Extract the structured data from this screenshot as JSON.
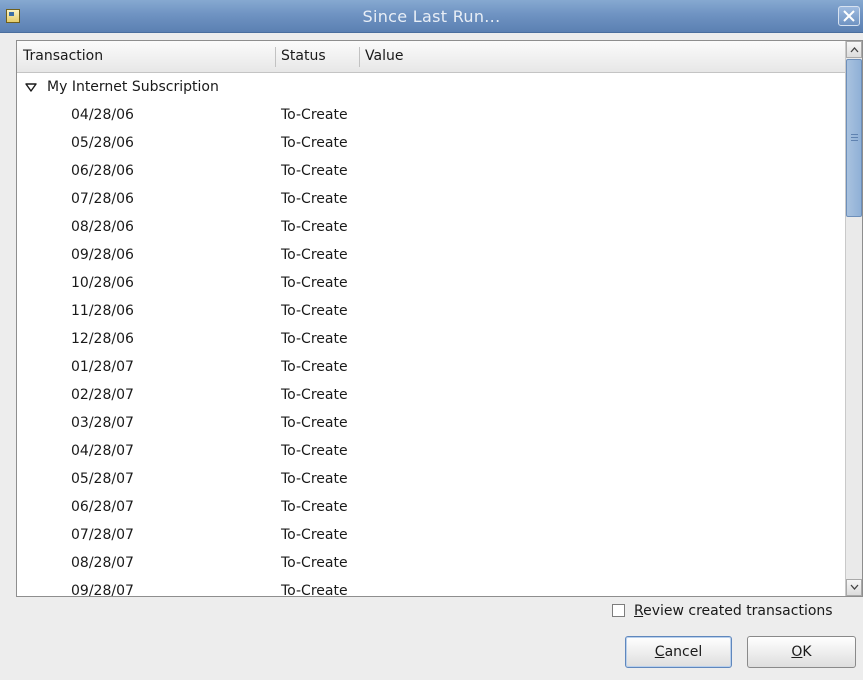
{
  "window": {
    "title": "Since Last Run...",
    "icon": "app-icon",
    "close_icon": "close-icon"
  },
  "table": {
    "columns": [
      "Transaction",
      "Status",
      "Value"
    ],
    "group": {
      "label": "My Internet Subscription",
      "expander_icon": "triangle-down-icon"
    },
    "rows": [
      {
        "date": "04/28/06",
        "status": "To-Create"
      },
      {
        "date": "05/28/06",
        "status": "To-Create"
      },
      {
        "date": "06/28/06",
        "status": "To-Create"
      },
      {
        "date": "07/28/06",
        "status": "To-Create"
      },
      {
        "date": "08/28/06",
        "status": "To-Create"
      },
      {
        "date": "09/28/06",
        "status": "To-Create"
      },
      {
        "date": "10/28/06",
        "status": "To-Create"
      },
      {
        "date": "11/28/06",
        "status": "To-Create"
      },
      {
        "date": "12/28/06",
        "status": "To-Create"
      },
      {
        "date": "01/28/07",
        "status": "To-Create"
      },
      {
        "date": "02/28/07",
        "status": "To-Create"
      },
      {
        "date": "03/28/07",
        "status": "To-Create"
      },
      {
        "date": "04/28/07",
        "status": "To-Create"
      },
      {
        "date": "05/28/07",
        "status": "To-Create"
      },
      {
        "date": "06/28/07",
        "status": "To-Create"
      },
      {
        "date": "07/28/07",
        "status": "To-Create"
      },
      {
        "date": "08/28/07",
        "status": "To-Create"
      },
      {
        "date": "09/28/07",
        "status": "To-Create"
      }
    ]
  },
  "review": {
    "mnemonic": "R",
    "rest": "eview created transactions",
    "checked": false
  },
  "buttons": {
    "cancel": {
      "mnemonic": "C",
      "rest": "ancel"
    },
    "ok": {
      "mnemonic": "O",
      "rest": "K"
    }
  },
  "colors": {
    "titlebar": "#6f93c2",
    "scroll_thumb": "#8fb0d6",
    "background": "#ededed"
  }
}
